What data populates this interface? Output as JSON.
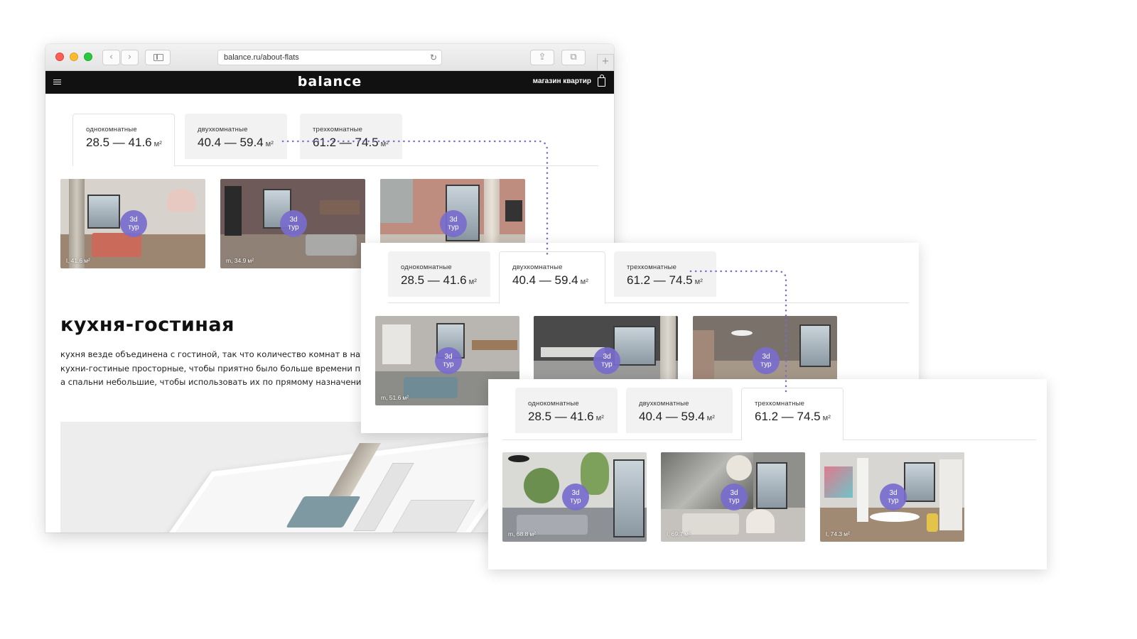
{
  "browser": {
    "url": "balance.ru/about-flats",
    "new_tab_glyph": "+",
    "back_glyph": "‹",
    "forward_glyph": "›",
    "share_glyph": "⇪",
    "tabs_glyph": "⧉",
    "reload_glyph": "↻"
  },
  "site": {
    "logo": "balance",
    "shop_link": "магазин квартир"
  },
  "tabs": [
    {
      "label": "однокомнатные",
      "range": "28.5 — 41.6",
      "unit": "м²"
    },
    {
      "label": "двухкомнатные",
      "range": "40.4 — 59.4",
      "unit": "м²"
    },
    {
      "label": "трехкомнатные",
      "range": "61.2 — 74.5",
      "unit": "м²"
    }
  ],
  "tour_badge": {
    "line1": "3d",
    "line2": "тур"
  },
  "panel1": {
    "thumbs": [
      {
        "area": "l, 41.6",
        "unit": "м²"
      },
      {
        "area": "m, 34.9",
        "unit": "м²"
      },
      {
        "area": "",
        "unit": ""
      }
    ]
  },
  "panel2": {
    "thumbs": [
      {
        "area": "m, 51.6",
        "unit": "м²"
      },
      {
        "area": "",
        "unit": ""
      },
      {
        "area": "",
        "unit": ""
      }
    ]
  },
  "panel3": {
    "thumbs": [
      {
        "area": "m, 68.8",
        "unit": "м²"
      },
      {
        "area": "l, 69.7",
        "unit": "м²"
      },
      {
        "area": "l, 74.3",
        "unit": "м²"
      }
    ]
  },
  "section": {
    "title": "кухня-гостиная",
    "lines": [
      "кухня везде объединена с гостиной, так что количество комнат в наз",
      "кухни-гостиные просторные, чтобы приятно было больше времени пр",
      "а спальни небольшие, чтобы использовать их по прямому назначени"
    ]
  },
  "colors": {
    "accent": "#786ccd",
    "nav_bg": "#111111",
    "tab_bg": "#f2f2f2"
  },
  "icons": [
    "menu-icon",
    "bag-icon",
    "reload-icon",
    "sidebar-icon",
    "share-icon",
    "tabs-icon"
  ]
}
